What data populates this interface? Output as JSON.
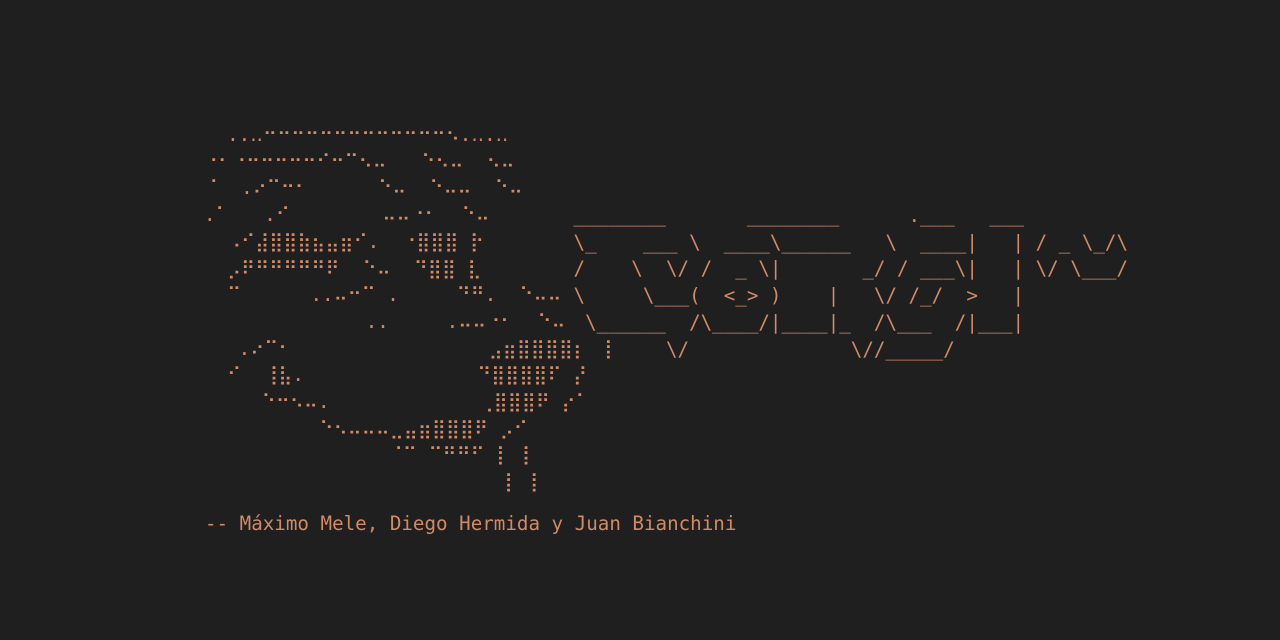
{
  "terminal": {
    "background": "#1f1f1f",
    "foreground": "#d08a68",
    "mascot_ascii": "  ..‥⠒⠒⠒⠒⠒⠒⠒⠒⠒⠒⠒⠒⠒⠢.‥.‥\n⠐⠂⠐⠒⠒⠒⠒⠒⠊⠒⠉⠢⠤   ⠑⠢⠤  ⠢⠤\n⠈  .⠔⠉⠒⠂      ⠑⠤  ⠑⠤⠤  ⠑⠤\n.⠁   .⠊        ⠤⠤⠐⠂  ⠑⠤\n  ⠠⠊⣼⣿⣿⣷⣦⣤⣶⠊.  ⠐⣿⣿⣿ ⡗\n  ⡠⠟⠛⠛⠛⠛⠛⠟  ⠑⠤  ⠙⣿⣿ ⣇\n  ⠉      ..⠤⠒⠉ .     ⠙⠛.  ⠑⠤⠤\n              ..     .⠤⠤⠐⠂  ⠑⠤\n   .⠔⠉⠂                 ⣠⣶⣿⣿⣿⣿⡆ ⢸\n  ⠊  ⢸⣧.               ⠙⣿⣿⣿⣿⠏ ⡜\n     ⠑⠒⠢⠤.             ⢀⣿⣿⣿⠟ ⡔⠁\n          ⠑⠢⠤⠤⠤⣀⣤⣶⣿⣿⣿⠟ ⡠⠊\n                ⠈⠉ ⠉⠛⠛⠋ ⡇ ⡇\n                          ⡇ ⡇",
    "logo_ascii": " ________       ________      .___   ___\n \\_    ___ \\  ____\\______   \\  ____|   | / _ \\_/\\\n /    \\  \\/ /  _ \\|       _/ / ___\\|   | \\/ \\___/\n \\     \\___(  <_> )    |   \\/ /_/  >   |\n  \\______  /\\____/|____|_  /\\___  /|___|\n         \\/              \\//_____/",
    "credit": "-- Máximo Mele, Diego Hermida y Juan Bianchini"
  }
}
